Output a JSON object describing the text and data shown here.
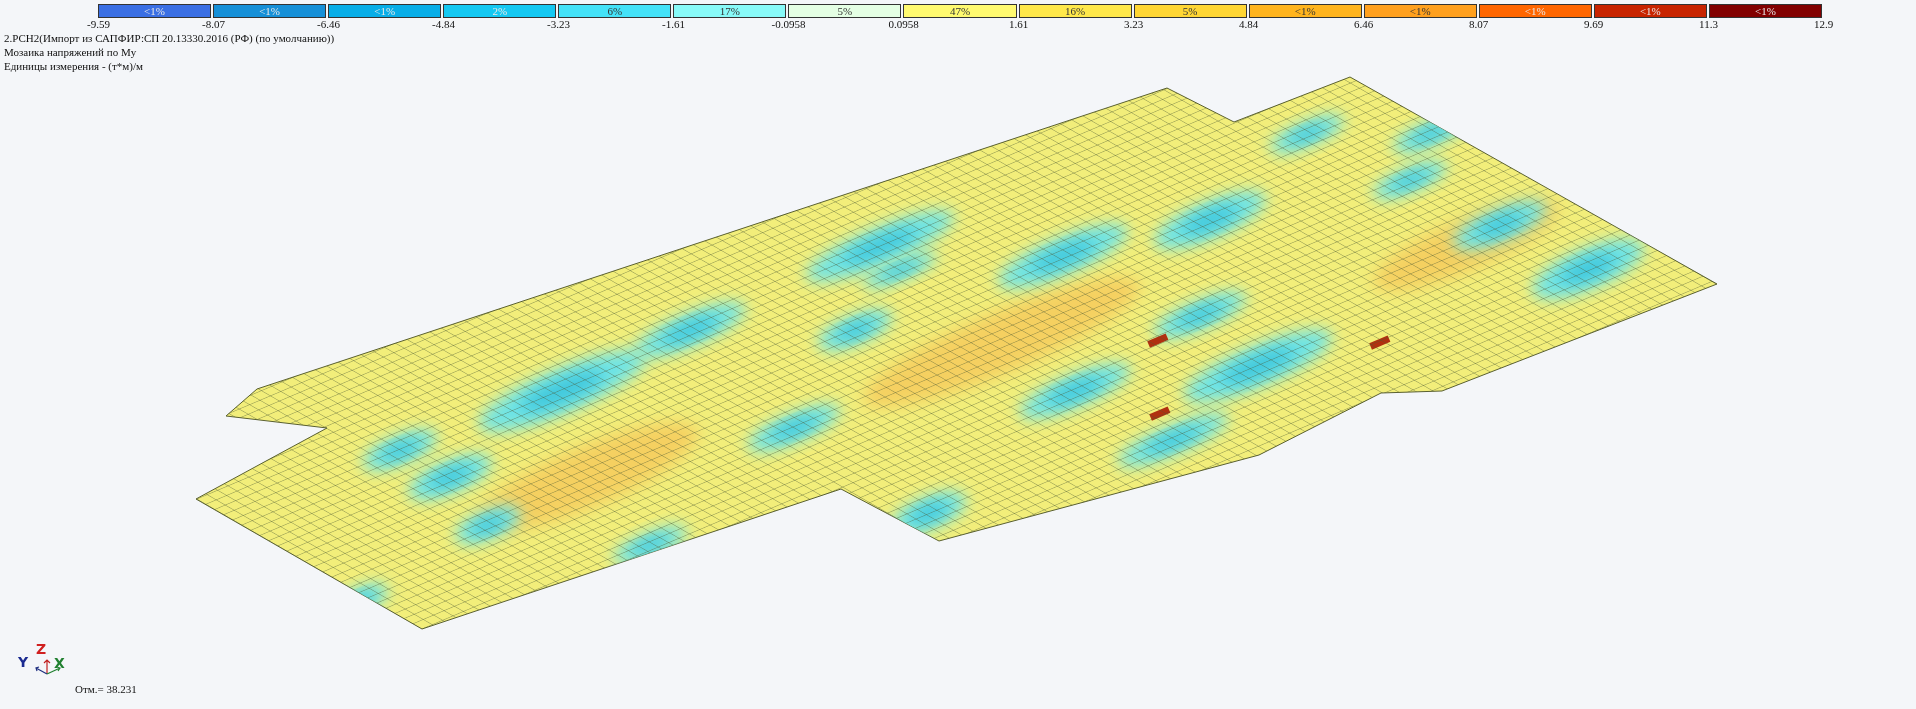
{
  "legend": {
    "cells": [
      {
        "label": "<1%",
        "color": "#3a6fe4"
      },
      {
        "label": "<1%",
        "color": "#1690d8"
      },
      {
        "label": "<1%",
        "color": "#08aee8"
      },
      {
        "label": "2%",
        "color": "#14c8f2"
      },
      {
        "label": "6%",
        "color": "#44e2f8"
      },
      {
        "label": "17%",
        "color": "#88faf8"
      },
      {
        "label": "5%",
        "color": "#e4ffe4"
      },
      {
        "label": "47%",
        "color": "#fffa70"
      },
      {
        "label": "16%",
        "color": "#ffe84a"
      },
      {
        "label": "5%",
        "color": "#ffd634"
      },
      {
        "label": "<1%",
        "color": "#ffb41e"
      },
      {
        "label": "<1%",
        "color": "#ffa01e"
      },
      {
        "label": "<1%",
        "color": "#ff6600"
      },
      {
        "label": "<1%",
        "color": "#c82400"
      },
      {
        "label": "<1%",
        "color": "#820000"
      }
    ],
    "ticks": [
      "-9.59",
      "-8.07",
      "-6.46",
      "-4.84",
      "-3.23",
      "-1.61",
      "-0.0958",
      "0.0958",
      "1.61",
      "3.23",
      "4.84",
      "6.46",
      "8.07",
      "9.69",
      "11.3",
      "12.9"
    ]
  },
  "info_lines": [
    "2.РСН2(Импорт из САПФИР:СП 20.13330.2016 (РФ) (по умолчанию))",
    "Мозаика напряжений по My",
    "Единицы измерения - (т*м)/м"
  ],
  "axes": {
    "y": "Y",
    "z": "Z",
    "x": "X"
  },
  "elevation": "Отм.= 38.231"
}
